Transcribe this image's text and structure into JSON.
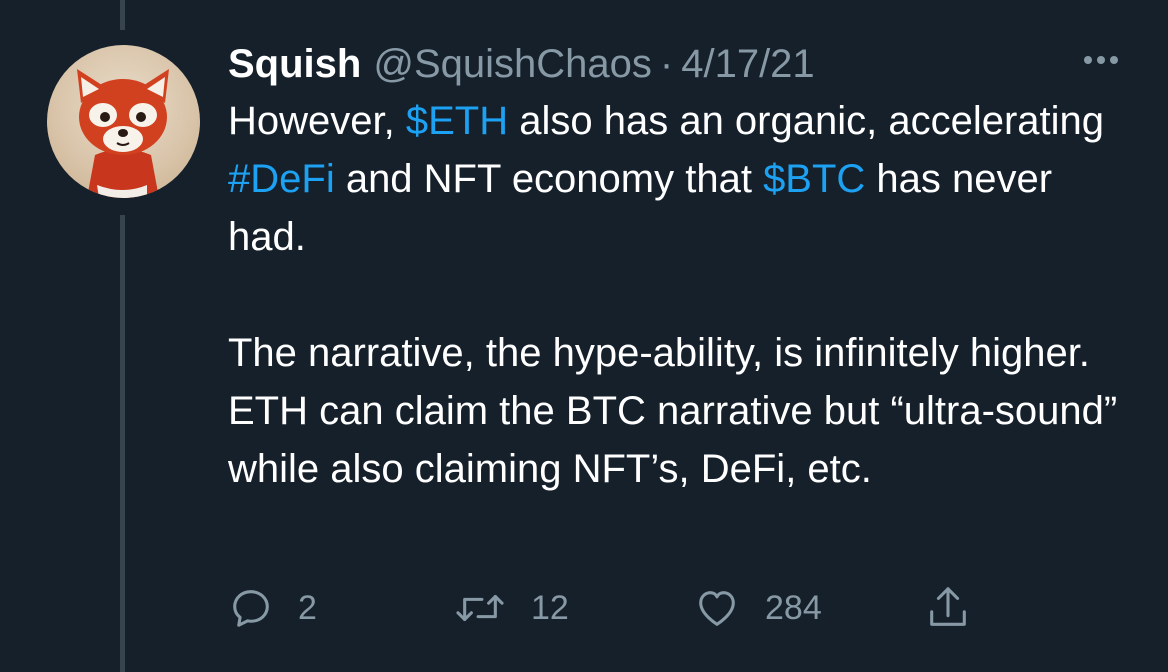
{
  "tweet": {
    "name": "Squish",
    "handle": "@SquishChaos",
    "separator": "·",
    "date": "4/17/21",
    "body": {
      "para1": {
        "t1": "However, ",
        "cashtag_eth": "$ETH",
        "t2": " also has an organic, accelerating ",
        "hashtag_defi": "#DeFi",
        "t3": " and NFT economy that ",
        "cashtag_btc": "$BTC",
        "t4": " has never had."
      },
      "para2": "The narrative, the hype-ability, is infinitely higher. ETH can claim the BTC narrative but “ultra-sound” while also claiming NFT’s, DeFi, etc."
    },
    "actions": {
      "reply_count": "2",
      "retweet_count": "12",
      "like_count": "284"
    }
  },
  "icons": {
    "avatar": "red-panda-avatar",
    "more": "more-options-icon",
    "reply": "reply-icon",
    "retweet": "retweet-icon",
    "like": "heart-icon",
    "share": "share-icon"
  },
  "colors": {
    "background": "#15202b",
    "link": "#1da1f2",
    "secondary_text": "#8899a6",
    "thread_line": "#38444d"
  }
}
